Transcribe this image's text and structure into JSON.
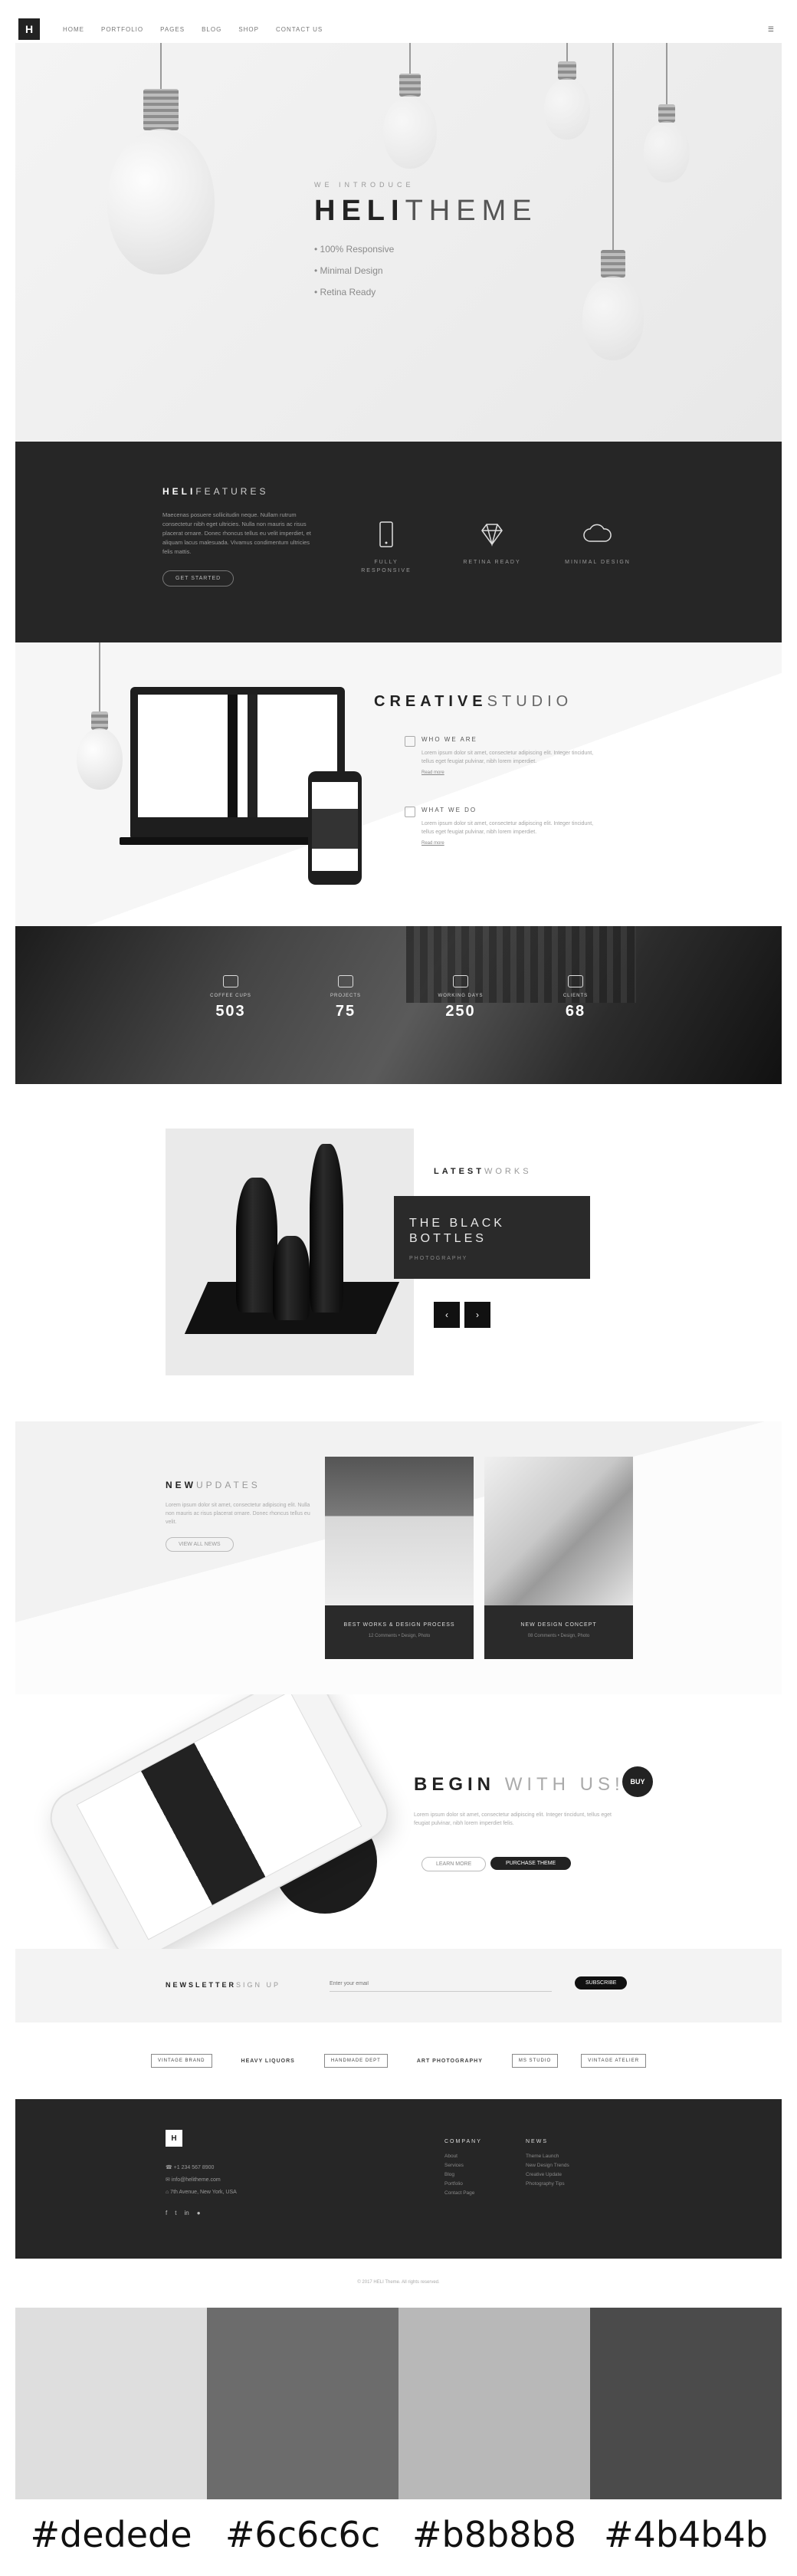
{
  "nav": {
    "logo": "H",
    "items": [
      "HOME",
      "PORTFOLIO",
      "PAGES",
      "BLOG",
      "SHOP",
      "CONTACT US"
    ],
    "cart": "☰"
  },
  "hero": {
    "subtitle": "WE INTRODUCE",
    "title_bold": "HELI",
    "title_light": "THEME",
    "features": [
      "• 100% Responsive",
      "• Minimal Design",
      "• Retina Ready"
    ]
  },
  "features": {
    "title_bold": "HELI",
    "title_light": "FEATURES",
    "description": "Maecenas posuere sollicitudin neque. Nullam rutrum consectetur nibh eget ultricies. Nulla non mauris ac risus placerat ornare. Donec rhoncus tellus eu velit imperdiet, et aliquam lacus malesuada. Vivamus condimentum ultricies felis mattis.",
    "button": "GET STARTED",
    "items": [
      {
        "icon": "phone-icon",
        "label": "FULLY RESPONSIVE"
      },
      {
        "icon": "diamond-icon",
        "label": "RETINA READY"
      },
      {
        "icon": "cloud-icon",
        "label": "MINIMAL DESIGN"
      }
    ]
  },
  "creative": {
    "title_bold": "CREATIVE",
    "title_light": "STUDIO",
    "items": [
      {
        "title": "WHO WE ARE",
        "text": "Lorem ipsum dolor sit amet, consectetur adipiscing elit. Integer tincidunt, tellus eget feugiat pulvinar, nibh lorem imperdiet.",
        "link": "Read more"
      },
      {
        "title": "WHAT WE DO",
        "text": "Lorem ipsum dolor sit amet, consectetur adipiscing elit. Integer tincidunt, tellus eget feugiat pulvinar, nibh lorem imperdiet.",
        "link": "Read more"
      }
    ]
  },
  "stats": [
    {
      "label": "COFFEE CUPS",
      "value": "503"
    },
    {
      "label": "PROJECTS",
      "value": "75"
    },
    {
      "label": "WORKING DAYS",
      "value": "250"
    },
    {
      "label": "CLIENTS",
      "value": "68"
    }
  ],
  "latest": {
    "title_bold": "LATEST",
    "title_light": "WORKS",
    "work_name": "THE BLACK BOTTLES",
    "work_category": "PHOTOGRAPHY",
    "prev": "‹",
    "next": "›"
  },
  "updates": {
    "title_bold": "NEW",
    "title_light": "UPDATES",
    "text": "Lorem ipsum dolor sit amet, consectetur adipiscing elit. Nulla non mauris ac risus placerat ornare. Donec rhoncus tellus eu velit.",
    "button": "VIEW ALL NEWS",
    "cards": [
      {
        "title": "BEST WORKS & DESIGN PROCESS",
        "meta": "12 Comments • Design, Photo"
      },
      {
        "title": "NEW DESIGN CONCEPT",
        "meta": "08 Comments • Design, Photo"
      }
    ]
  },
  "begin": {
    "title_bold": "BEGIN",
    "title_light": "WITH US!",
    "badge": "BUY",
    "text": "Lorem ipsum dolor sit amet, consectetur adipiscing elit. Integer tincidunt, tellus eget feugiat pulvinar, nibh lorem imperdiet felis.",
    "btn_secondary": "LEARN MORE",
    "btn_primary": "PURCHASE THEME"
  },
  "newsletter": {
    "title_bold": "NEWSLETTER",
    "title_light": "SIGN UP",
    "placeholder": "Enter your email",
    "button": "SUBSCRIBE"
  },
  "clients": [
    "VINTAGE BRAND",
    "HEAVY LIQUORS",
    "HANDMADE DEPT",
    "ART PHOTOGRAPHY",
    "MS STUDIO",
    "VINTAGE ATELIER"
  ],
  "footer": {
    "logo": "H",
    "info": [
      "☎ +1 234 567 8900",
      "✉ info@helitheme.com",
      "⌂ 7th Avenue, New York, USA"
    ],
    "social": [
      "f",
      "t",
      "in",
      "●"
    ],
    "col1_title": "COMPANY",
    "col1_items": [
      "About",
      "Services",
      "Blog",
      "Portfolio",
      "Contact Page"
    ],
    "col2_title": "NEWS",
    "col2_items": [
      "Theme Launch",
      "New Design Trends",
      "Creative Update",
      "Photography Tips"
    ]
  },
  "copyright": "© 2017 HELI Theme. All rights reserved.",
  "palette": [
    {
      "hex": "#dedede"
    },
    {
      "hex": "#6c6c6c"
    },
    {
      "hex": "#b8b8b8"
    },
    {
      "hex": "#4b4b4b"
    }
  ]
}
